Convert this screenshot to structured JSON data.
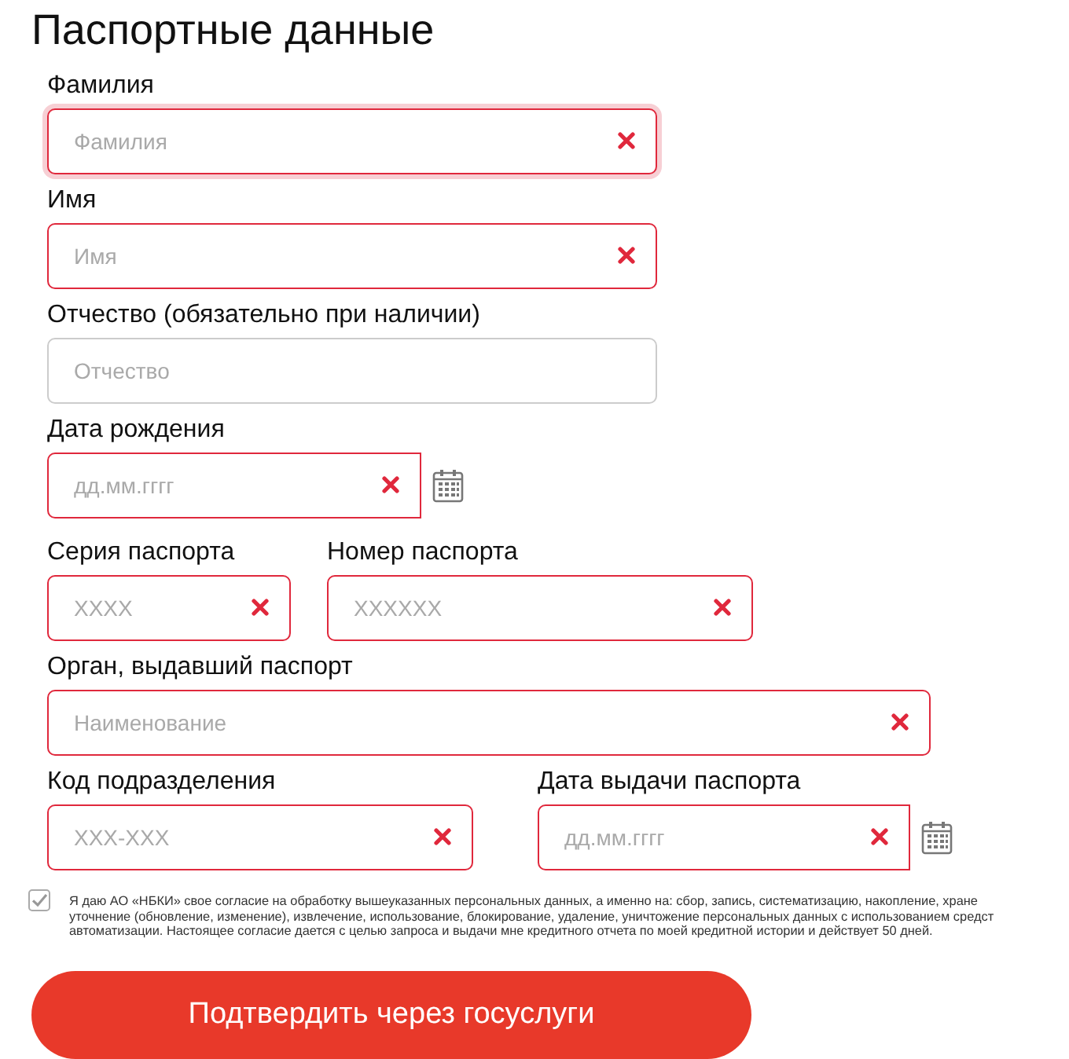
{
  "title": "Паспортные данные",
  "rows": [
    [
      {
        "kind": "text",
        "label": "Фамилия",
        "placeholder": "Фамилия",
        "error": true,
        "focused": true
      }
    ],
    [
      {
        "kind": "text",
        "label": "Имя",
        "placeholder": "Имя",
        "error": true,
        "focused": false
      }
    ],
    [
      {
        "kind": "text",
        "label": "Отчество (обязательно при наличии)",
        "placeholder": "Отчество",
        "error": false,
        "focused": false
      }
    ],
    [
      {
        "kind": "date",
        "label": "Дата рождения",
        "placeholder": "дд.мм.гггг",
        "error": true,
        "focused": false
      }
    ],
    [
      {
        "kind": "text",
        "label": "Серия паспорта",
        "placeholder": "XXXX",
        "error": true,
        "focused": false
      },
      {
        "kind": "text",
        "label": "Номер паспорта",
        "placeholder": "XXXXXX",
        "error": true,
        "focused": false
      }
    ],
    [
      {
        "kind": "text",
        "label": "Орган, выдавший паспорт",
        "placeholder": "Наименование",
        "error": true,
        "focused": false
      }
    ],
    [
      {
        "kind": "text",
        "label": "Код подразделения",
        "placeholder": "XXX-XXX",
        "error": true,
        "focused": false
      },
      {
        "kind": "date",
        "label": "Дата выдачи паспорта",
        "placeholder": "дд.мм.гггг",
        "error": true,
        "focused": false
      }
    ]
  ],
  "consent": {
    "checked": true,
    "lines": [
      "Я даю АО «НБКИ» свое согласие на обработку вышеуказанных персональных данных, а именно на: сбор, запись, систематизацию, накопление, хране",
      "уточнение (обновление, изменение), извлечение, использование, блокирование, удаление, уничтожение персональных данных с использованием средст",
      "автоматизации. Настоящее согласие дается с целью запроса и выдачи мне кредитного отчета по моей кредитной истории и действует 50 дней."
    ]
  },
  "submit": "Подтвердить через госуслуги"
}
